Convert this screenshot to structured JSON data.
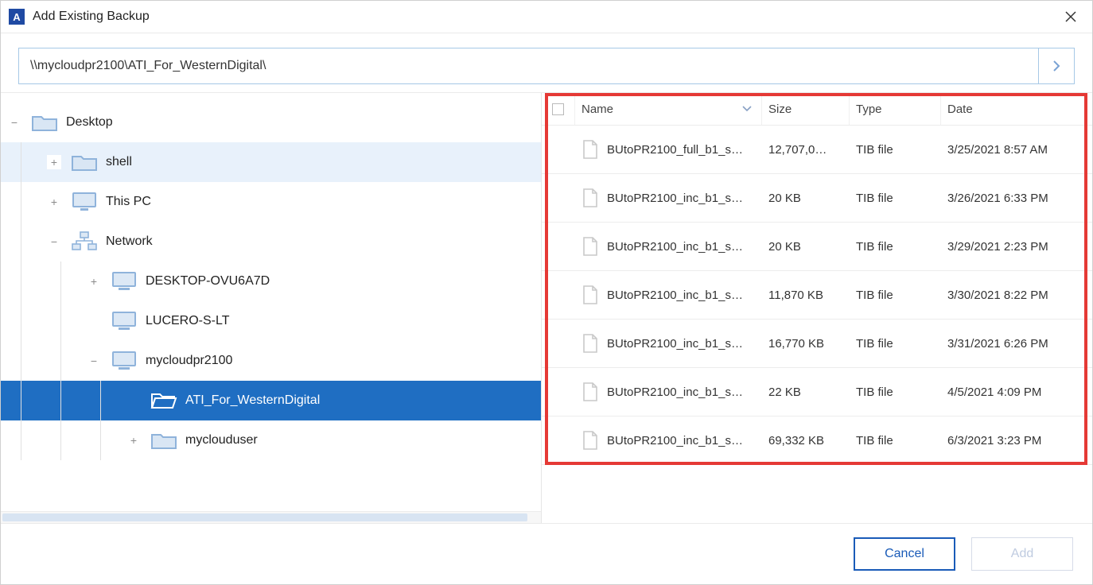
{
  "window": {
    "title": "Add Existing Backup",
    "app_glyph": "A"
  },
  "path": {
    "value": "\\\\mycloudpr2100\\ATI_For_WesternDigital\\"
  },
  "tree": {
    "items": [
      {
        "id": "desktop",
        "label": "Desktop",
        "depth": 0,
        "icon": "folder",
        "toggle": "minus",
        "selected": false,
        "hover": false
      },
      {
        "id": "shell",
        "label": "shell",
        "depth": 1,
        "icon": "folder",
        "toggle": "plus",
        "selected": false,
        "hover": true
      },
      {
        "id": "thispc",
        "label": "This PC",
        "depth": 1,
        "icon": "pc",
        "toggle": "plus",
        "selected": false,
        "hover": false
      },
      {
        "id": "network",
        "label": "Network",
        "depth": 1,
        "icon": "network",
        "toggle": "minus",
        "selected": false,
        "hover": false
      },
      {
        "id": "desktop-ovu",
        "label": "DESKTOP-OVU6A7D",
        "depth": 2,
        "icon": "computer",
        "toggle": "plus",
        "selected": false,
        "hover": false
      },
      {
        "id": "lucero",
        "label": "LUCERO-S-LT",
        "depth": 2,
        "icon": "computer",
        "toggle": "none",
        "selected": false,
        "hover": false
      },
      {
        "id": "mycloud",
        "label": "mycloudpr2100",
        "depth": 2,
        "icon": "computer",
        "toggle": "minus",
        "selected": false,
        "hover": false
      },
      {
        "id": "ati",
        "label": "ATI_For_WesternDigital",
        "depth": 3,
        "icon": "folder-open",
        "toggle": "none",
        "selected": true,
        "hover": false
      },
      {
        "id": "myclouduser",
        "label": "myclouduser",
        "depth": 3,
        "icon": "folder",
        "toggle": "plus",
        "selected": false,
        "hover": false
      }
    ]
  },
  "columns": {
    "name": "Name",
    "size": "Size",
    "type": "Type",
    "date": "Date"
  },
  "files": [
    {
      "name": "BUtoPR2100_full_b1_s…",
      "size": "12,707,0…",
      "type": "TIB file",
      "date": "3/25/2021 8:57 AM"
    },
    {
      "name": "BUtoPR2100_inc_b1_s…",
      "size": "20 KB",
      "type": "TIB file",
      "date": "3/26/2021 6:33 PM"
    },
    {
      "name": "BUtoPR2100_inc_b1_s…",
      "size": "20 KB",
      "type": "TIB file",
      "date": "3/29/2021 2:23 PM"
    },
    {
      "name": "BUtoPR2100_inc_b1_s…",
      "size": "11,870 KB",
      "type": "TIB file",
      "date": "3/30/2021 8:22 PM"
    },
    {
      "name": "BUtoPR2100_inc_b1_s…",
      "size": "16,770 KB",
      "type": "TIB file",
      "date": "3/31/2021 6:26 PM"
    },
    {
      "name": "BUtoPR2100_inc_b1_s…",
      "size": "22 KB",
      "type": "TIB file",
      "date": "4/5/2021 4:09 PM"
    },
    {
      "name": "BUtoPR2100_inc_b1_s…",
      "size": "69,332 KB",
      "type": "TIB file",
      "date": "6/3/2021 3:23 PM"
    }
  ],
  "footer": {
    "cancel": "Cancel",
    "add": "Add"
  }
}
